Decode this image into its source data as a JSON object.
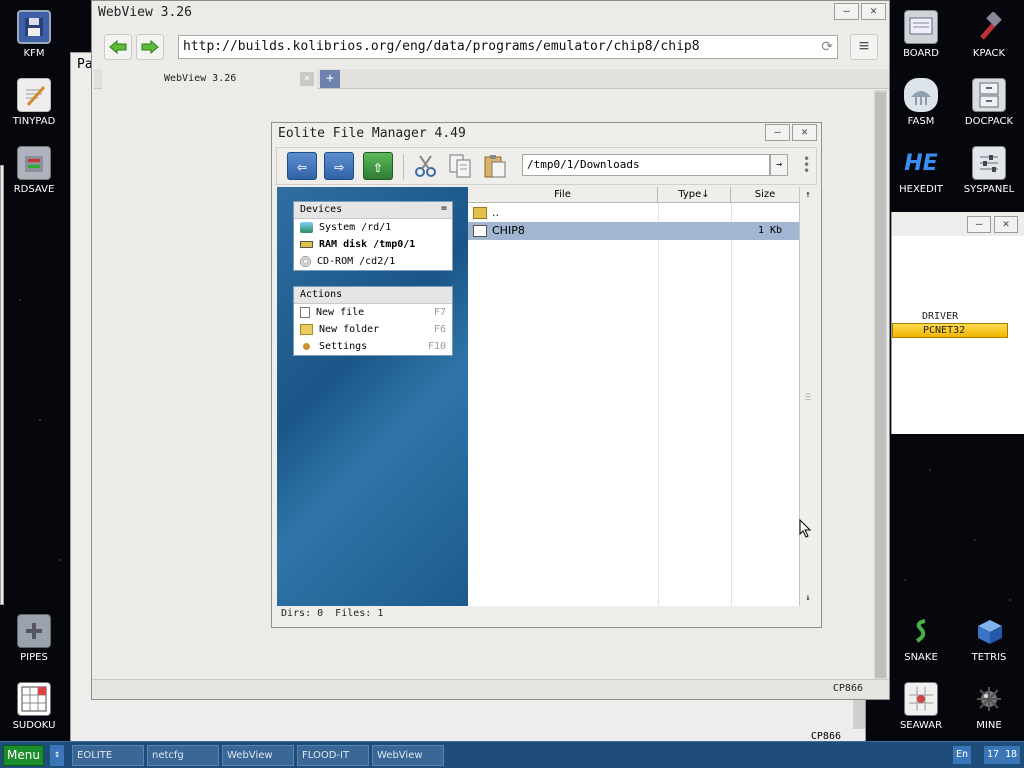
{
  "desktop": {
    "left_icons": [
      {
        "label": "KFM",
        "icon": "floppy-icon"
      },
      {
        "label": "TINYPAD",
        "icon": "notepad-icon"
      },
      {
        "label": "RDSAVE",
        "icon": "disk-save-icon"
      },
      {
        "label": "PIPES",
        "icon": "pipes-icon"
      },
      {
        "label": "SUDOKU",
        "icon": "sudoku-icon"
      }
    ],
    "right_icons": [
      {
        "label": "BOARD",
        "icon": "board-icon"
      },
      {
        "label": "KPACK",
        "icon": "hammer-icon"
      },
      {
        "label": "FASM",
        "icon": "fasm-icon"
      },
      {
        "label": "DOCPACK",
        "icon": "cabinet-icon"
      },
      {
        "label": "HEXEDIT",
        "icon": "hex-icon",
        "glyph": "HE"
      },
      {
        "label": "SYSPANEL",
        "icon": "sliders-icon"
      },
      {
        "label": "SNAKE",
        "icon": "snake-icon"
      },
      {
        "label": "TETRIS",
        "icon": "tetris-icon"
      },
      {
        "label": "SEAWAR",
        "icon": "grid-icon"
      },
      {
        "label": "MINE",
        "icon": "mine-icon"
      }
    ]
  },
  "background_window": {
    "title_fragment": "Pa",
    "status": "CP866"
  },
  "webview": {
    "title": "WebView 3.26",
    "url": "http://builds.kolibrios.org/eng/data/programs/emulator/chip8/chip8",
    "tab_label": "WebView 3.26",
    "tab_close": "×",
    "tab_add": "+",
    "status_encoding": "CP866",
    "minimize": "—",
    "close": "✕"
  },
  "eolite": {
    "title": "Eolite File Manager 4.49",
    "path": "/tmp0/1/Downloads",
    "go": "→",
    "devices": {
      "header": "Devices",
      "header_icon": "=",
      "items": [
        {
          "label": "System /rd/1",
          "icon": "system-icon",
          "bold": false
        },
        {
          "label": "RAM disk /tmp0/1",
          "icon": "ram-icon",
          "bold": true
        },
        {
          "label": "CD-ROM /cd2/1",
          "icon": "cdrom-icon",
          "bold": false
        }
      ]
    },
    "actions": {
      "header": "Actions",
      "items": [
        {
          "label": "New file",
          "key": "F7",
          "icon": "new-file-icon"
        },
        {
          "label": "New folder",
          "key": "F6",
          "icon": "new-folder-icon"
        },
        {
          "label": "Settings",
          "key": "F10",
          "icon": "settings-icon"
        }
      ]
    },
    "columns": {
      "file": "File",
      "type": "Type↓",
      "size": "Size"
    },
    "files": [
      {
        "name": "..",
        "size": "",
        "selected": false,
        "icon": "folder-up-icon"
      },
      {
        "name": "CHIP8",
        "size": "1 Kb",
        "selected": true,
        "icon": "file-icon"
      }
    ],
    "status": "Dirs: 0  Files: 1"
  },
  "right_window": {
    "driver_label": "DRIVER",
    "driver_name": "PCNET32"
  },
  "taskbar": {
    "menu": "Menu",
    "switch_glyph": "↕",
    "tasks": [
      "EOLITE",
      "netcfg",
      "WebView",
      "FLOOD-IT",
      "WebView"
    ],
    "lang": "En",
    "time": "17 18"
  }
}
